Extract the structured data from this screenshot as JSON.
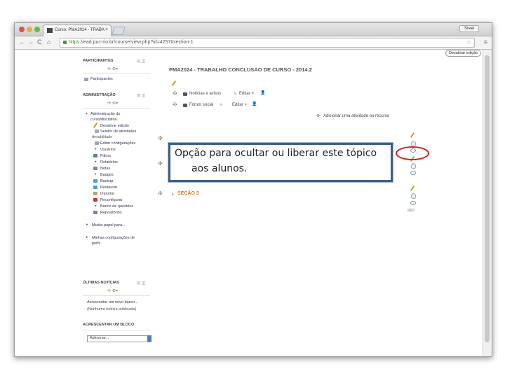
{
  "browser": {
    "tab_title": "Curso: PMA2024 - TRABA",
    "tab_close": "×",
    "user_button": "Sreei",
    "url_https": "https",
    "url_rest": "://ead.puc-rio.br/course/view.php?id=4257#section-1",
    "back": "←",
    "forward": "→",
    "reload": "C",
    "home": "⌂",
    "star": "☆",
    "menu": "≡"
  },
  "page": {
    "edit_button": "Desativar edição",
    "course_title": "PMA2024 - TRABALHO CONCLUSAO DE CURSO - 2014.2"
  },
  "sidebar": {
    "participants": {
      "title": "PARTICIPANTES",
      "item": "Participantes"
    },
    "admin": {
      "title": "ADMINISTRAÇÃO",
      "course_admin_1": "Administração do",
      "course_admin_2": "curso/disciplina",
      "items": [
        "Desativar edição",
        "Seletor de atividades",
        "desabilitado",
        "Editar configurações",
        "Usuários",
        "Filtros",
        "Relatórios",
        "Notas",
        "Badges",
        "Backup",
        "Restaurar",
        "Importar",
        "Reconfigurar",
        "Banco de questões",
        "Repositórios"
      ],
      "switch_role": "Mudar papel para...",
      "profile_1": "Minhas configurações de",
      "profile_2": "perfil"
    },
    "news": {
      "title": "ÚLTIMAS NOTÍCIAS",
      "add": "Acrescentar um novo tópico...",
      "none": "(Nenhuma notícia publicada)"
    },
    "add_block": {
      "title": "ACRESCENTAR UM BLOCO",
      "select": "Adicionar..."
    }
  },
  "main": {
    "forum_news": "Notícias e avisos",
    "forum_social": "Fórum social",
    "edit_label": "Editar",
    "add_activity": "Adicionar uma atividade ou recurso",
    "section3": "SEÇÃO 3"
  },
  "callout": {
    "line1": "Opção para ocultar ou liberar este tópico",
    "line2": "aos alunos."
  }
}
